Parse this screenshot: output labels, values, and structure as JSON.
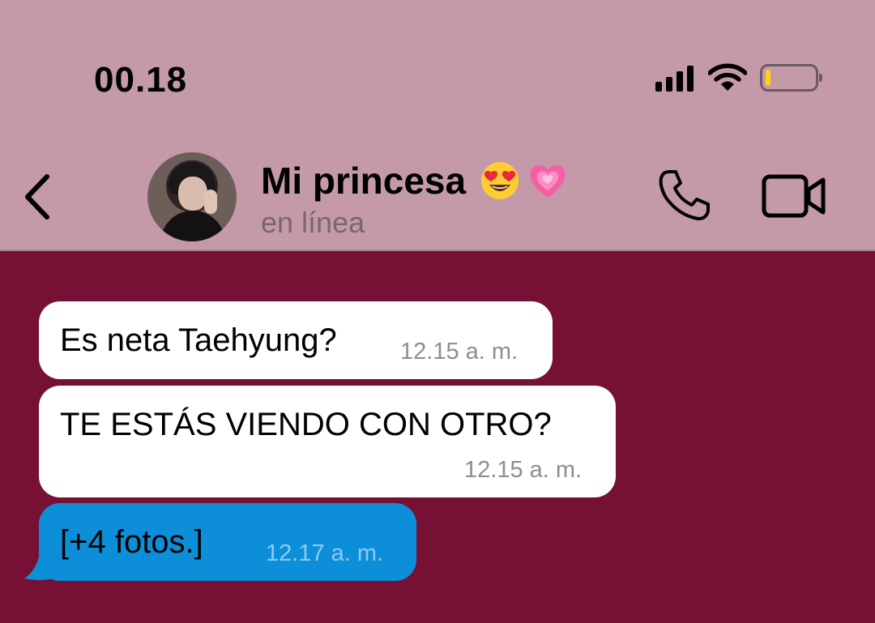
{
  "status_bar": {
    "time": "00.18",
    "signal_icon": "cellular-signal-icon",
    "wifi_icon": "wifi-icon",
    "battery_icon": "battery-low-icon",
    "battery_level": 0.1
  },
  "chat_header": {
    "back_icon": "chevron-left-icon",
    "contact_name": "Mi princesa",
    "name_emojis": [
      "heart-eyes-emoji",
      "growing-heart-emoji"
    ],
    "contact_status": "en línea",
    "call_icon": "phone-icon",
    "video_icon": "video-camera-icon"
  },
  "messages": [
    {
      "direction": "incoming",
      "text": "Es neta Taehyung?",
      "time": "12.15 a. m."
    },
    {
      "direction": "incoming",
      "text": "TE ESTÁS VIENDO CON OTRO?",
      "time": "12.15 a. m."
    },
    {
      "direction": "outgoing",
      "text": "[+4 fotos.]",
      "time": "12.17 a. m."
    }
  ],
  "colors": {
    "header_bg": "#c49aa8",
    "chat_bg": "#761034",
    "incoming_bubble": "#ffffff",
    "outgoing_bubble": "#0c8fd8",
    "battery_fill": "#ffd60a"
  }
}
